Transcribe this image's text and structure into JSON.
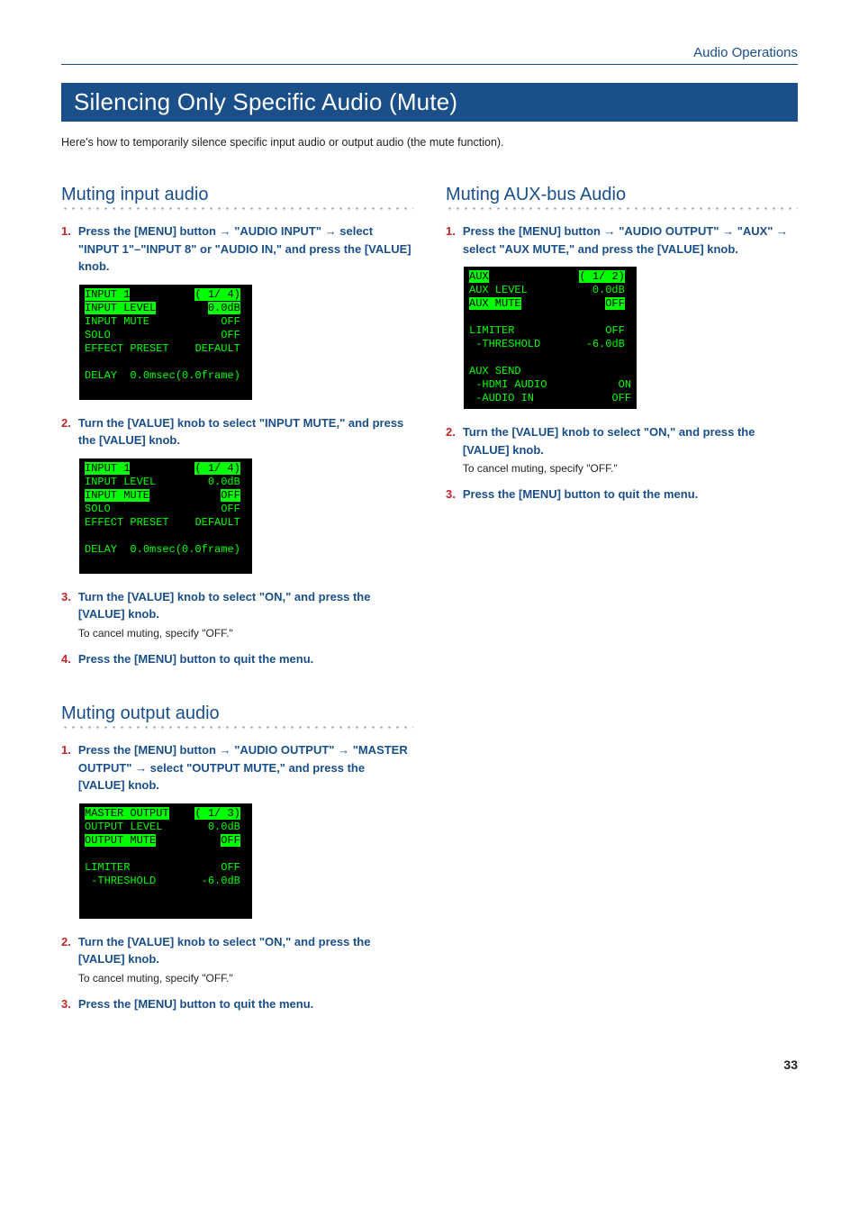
{
  "breadcrumb": "Audio Operations",
  "title": "Silencing Only Specific Audio (Mute)",
  "intro": "Here's how to temporarily silence specific input audio or output audio (the mute function).",
  "page_number": "33",
  "arrow": "→",
  "left": {
    "sec1": {
      "heading": "Muting input audio",
      "step1": {
        "num": "1.",
        "pre": "Press the [MENU] button ",
        "mid1": " \"AUDIO INPUT\" ",
        "post": " select \"INPUT 1\"–\"INPUT 8\" or \"AUDIO IN,\" and press the [VALUE] knob."
      },
      "lcd1": {
        "title": "INPUT 1",
        "pager": "( 1/ 4)",
        "r1l": "INPUT LEVEL",
        "r1v": "0.0dB",
        "r2l": "INPUT MUTE",
        "r2v": "OFF",
        "r3l": "SOLO",
        "r3v": "OFF",
        "r4l": "EFFECT PRESET",
        "r4v": "DEFAULT",
        "r5l": "DELAY",
        "r5v": "0.0msec(0.0frame)"
      },
      "step2": {
        "num": "2.",
        "text": "Turn the [VALUE] knob to select \"INPUT MUTE,\" and press the [VALUE] knob."
      },
      "step3": {
        "num": "3.",
        "text": "Turn the [VALUE] knob to select \"ON,\" and press the [VALUE] knob.",
        "note": "To cancel muting, specify \"OFF.\""
      },
      "step4": {
        "num": "4.",
        "text": "Press the [MENU] button to quit the menu."
      }
    },
    "sec2": {
      "heading": "Muting output audio",
      "step1": {
        "num": "1.",
        "pre": "Press the [MENU] button ",
        "mid1": " \"AUDIO OUTPUT\" ",
        "mid2": " \"MASTER OUTPUT\" ",
        "post": " select \"OUTPUT MUTE,\" and press the [VALUE] knob."
      },
      "lcd": {
        "title": "MASTER OUTPUT",
        "pager": "( 1/ 3)",
        "r1l": "OUTPUT LEVEL",
        "r1v": "0.0dB",
        "r2l": "OUTPUT MUTE",
        "r2v": "OFF",
        "r3l": "LIMITER",
        "r3v": "OFF",
        "r4l": " -THRESHOLD",
        "r4v": "-6.0dB"
      },
      "step2": {
        "num": "2.",
        "text": "Turn the [VALUE] knob to select \"ON,\" and press the [VALUE] knob.",
        "note": "To cancel muting, specify \"OFF.\""
      },
      "step3": {
        "num": "3.",
        "text": "Press the [MENU] button to quit the menu."
      }
    }
  },
  "right": {
    "sec1": {
      "heading": "Muting AUX-bus Audio",
      "step1": {
        "num": "1.",
        "pre": "Press the [MENU] button ",
        "mid1": " \"AUDIO OUTPUT\" ",
        "mid2": " \"AUX\" ",
        "post": " select \"AUX MUTE,\" and press the [VALUE] knob."
      },
      "lcd": {
        "title": "AUX",
        "pager": "( 1/ 2)",
        "r1l": "AUX LEVEL",
        "r1v": "0.0dB",
        "r2l": "AUX MUTE",
        "r2v": "OFF",
        "r3l": "LIMITER",
        "r3v": "OFF",
        "r4l": " -THRESHOLD",
        "r4v": "-6.0dB",
        "r5l": "AUX SEND",
        "r6l": " -HDMI AUDIO",
        "r6v": "ON",
        "r7l": " -AUDIO IN",
        "r7v": "OFF"
      },
      "step2": {
        "num": "2.",
        "text": "Turn the [VALUE] knob to select \"ON,\" and press the [VALUE] knob.",
        "note": "To cancel muting, specify \"OFF.\""
      },
      "step3": {
        "num": "3.",
        "text": "Press the [MENU] button to quit the menu."
      }
    }
  }
}
